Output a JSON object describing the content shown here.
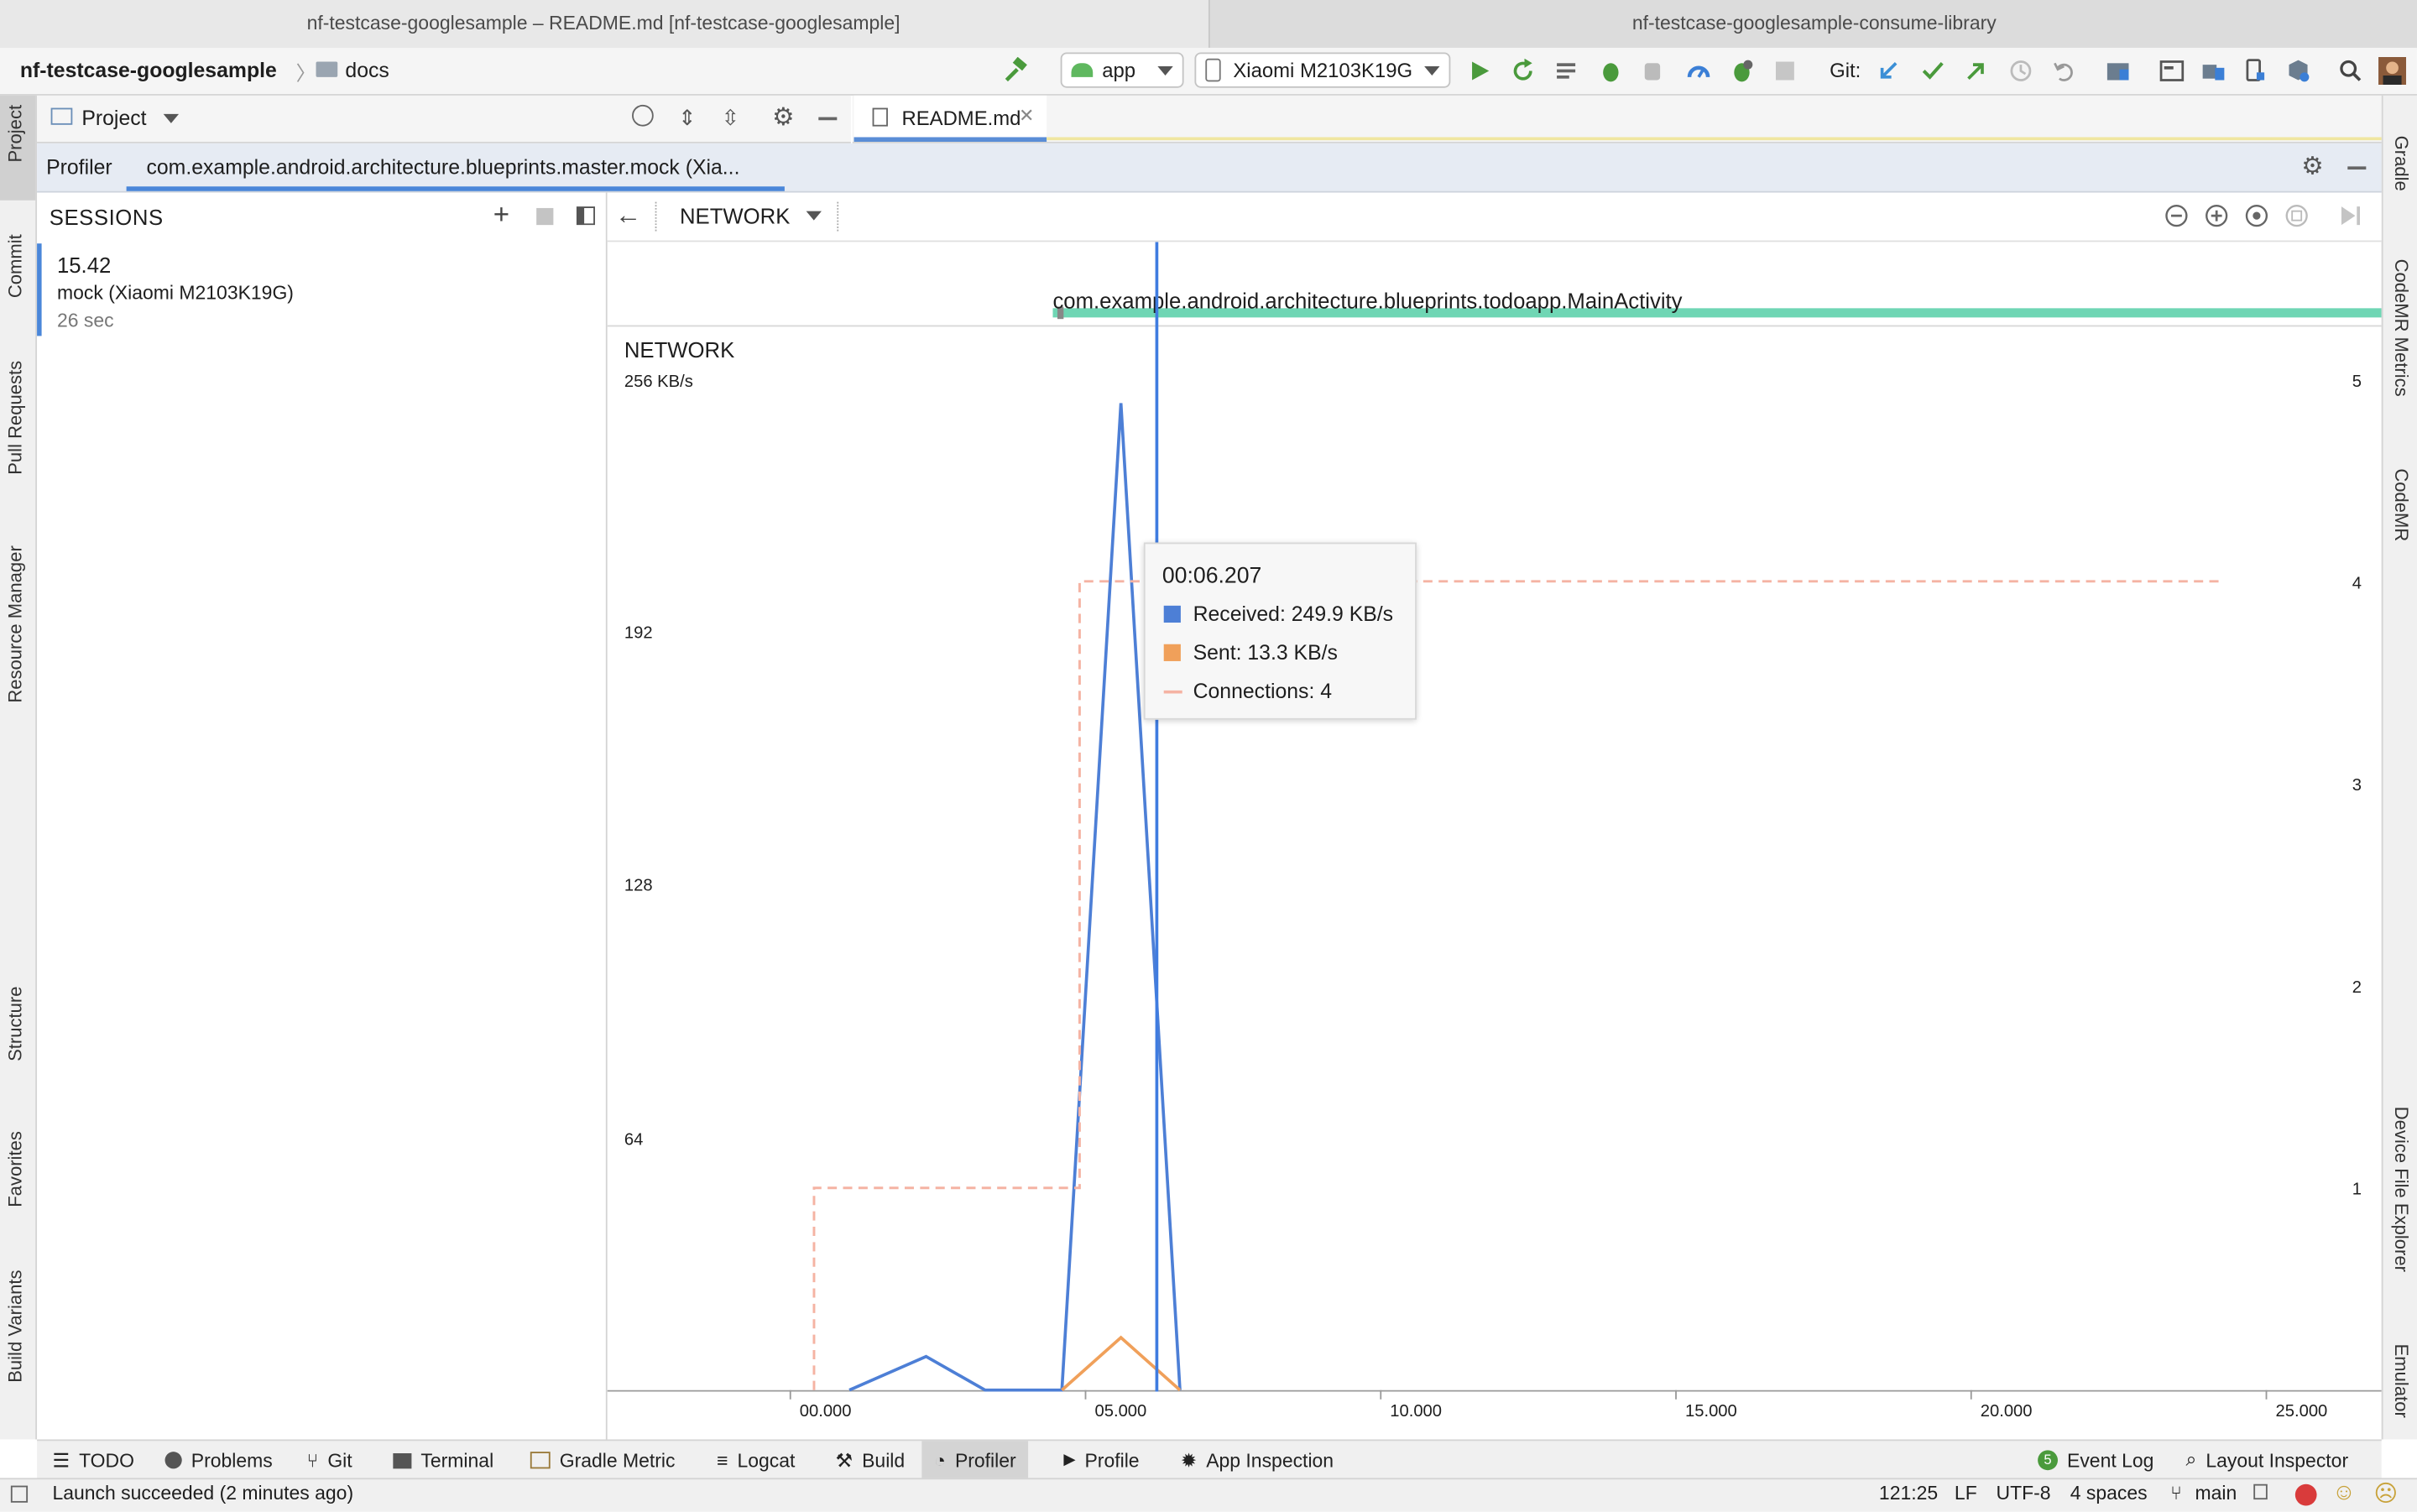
{
  "window_tabs": [
    {
      "label": "nf-testcase-googlesample – README.md [nf-testcase-googlesample]",
      "active": true
    },
    {
      "label": "nf-testcase-googlesample-consume-library",
      "active": false
    }
  ],
  "toolbar": {
    "project": "nf-testcase-googlesample",
    "breadcrumb": "docs",
    "run_config": "app",
    "device": "Xiaomi M2103K19G",
    "git_label": "Git:"
  },
  "project_panel": {
    "title": "Project"
  },
  "editor_tab": {
    "label": "README.md"
  },
  "profiler": {
    "tab_label": "Profiler",
    "session_tab": "com.example.android.architecture.blueprints.master.mock (Xia..."
  },
  "sessions": {
    "header": "SESSIONS",
    "items": [
      {
        "time": "15.42",
        "name": "mock (Xiaomi M2103K19G)",
        "duration": "26 sec"
      }
    ]
  },
  "network": {
    "dropdown": "NETWORK",
    "activity": "com.example.android.architecture.blueprints.todoapp.MainActivity"
  },
  "chart_data": {
    "type": "line",
    "title": "NETWORK",
    "ylabel": "KB/s",
    "y_top_label": "256 KB/s",
    "y_ticks": [
      "192",
      "128",
      "64"
    ],
    "y2_ticks": [
      "5",
      "4",
      "3",
      "2",
      "1"
    ],
    "ylim": [
      0,
      256
    ],
    "y2lim": [
      0,
      5
    ],
    "x_ticks": [
      "00.000",
      "05.000",
      "10.000",
      "15.000",
      "20.000",
      "25.000"
    ],
    "xlim": [
      -3.1,
      26.95
    ],
    "cursor_x": 6.207,
    "series": [
      {
        "name": "Received",
        "color": "#4d7fd6",
        "points": [
          [
            1.0,
            0
          ],
          [
            2.3,
            8.5
          ],
          [
            3.3,
            0
          ],
          [
            4.6,
            0
          ],
          [
            5.6,
            249.9
          ],
          [
            6.6,
            0
          ]
        ]
      },
      {
        "name": "Sent",
        "color": "#f0a05a",
        "points": [
          [
            4.6,
            0
          ],
          [
            5.6,
            13.3
          ],
          [
            6.6,
            0
          ]
        ]
      },
      {
        "name": "Connections",
        "color": "#f5b3a3",
        "dashed": true,
        "axis": "right",
        "points": [
          [
            0.4,
            0
          ],
          [
            0.4,
            1
          ],
          [
            4.9,
            1
          ],
          [
            4.9,
            4
          ],
          [
            24.2,
            4
          ]
        ]
      }
    ],
    "tooltip": {
      "time": "00:06.207",
      "rows": [
        {
          "label": "Received: 249.9 KB/s",
          "color": "#4d7fd6",
          "kind": "box"
        },
        {
          "label": "Sent: 13.3 KB/s",
          "color": "#f0a05a",
          "kind": "box"
        },
        {
          "label": "Connections: 4",
          "color": "#f5b3a3",
          "kind": "dash"
        }
      ]
    }
  },
  "left_tool_windows": [
    "Project",
    "Commit",
    "Pull Requests",
    "Resource Manager",
    "Structure",
    "Favorites",
    "Build Variants"
  ],
  "right_tool_windows": [
    "Gradle",
    "CodeMR Metrics",
    "CodeMR",
    "Device File Explorer",
    "Emulator"
  ],
  "bottom_tool_windows": [
    "TODO",
    "Problems",
    "Git",
    "Terminal",
    "Gradle Metric",
    "Logcat",
    "Build",
    "Profiler",
    "Profile",
    "App Inspection"
  ],
  "bottom_right": {
    "event_log": "Event Log",
    "event_count": "5",
    "layout_inspector": "Layout Inspector"
  },
  "status": {
    "message": "Launch succeeded (2 minutes ago)",
    "position": "121:25",
    "line_sep": "LF",
    "encoding": "UTF-8",
    "indent": "4 spaces",
    "branch": "main"
  }
}
